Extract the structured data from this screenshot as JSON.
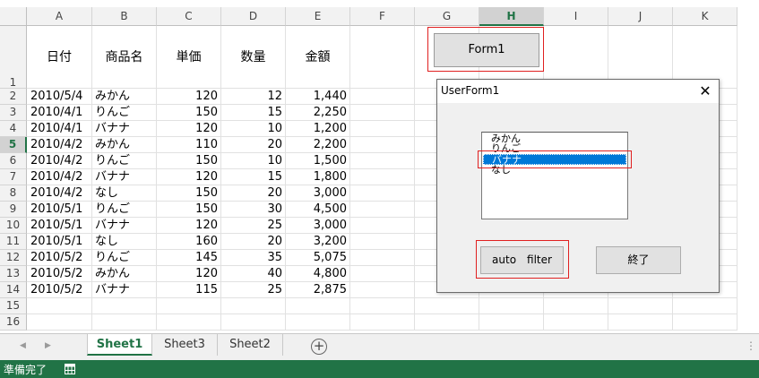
{
  "sheet": {
    "columns": [
      "A",
      "B",
      "C",
      "D",
      "E",
      "F",
      "G",
      "H",
      "I",
      "J",
      "K"
    ],
    "selected_column": "H",
    "selected_row": "5",
    "row_numbers": [
      "1",
      "2",
      "3",
      "4",
      "5",
      "6",
      "7",
      "8",
      "9",
      "10",
      "11",
      "12",
      "13",
      "14",
      "15",
      "16"
    ],
    "headers": [
      "日付",
      "商品名",
      "単価",
      "数量",
      "金額"
    ],
    "rows": [
      [
        "2010/5/4",
        "みかん",
        "120",
        "12",
        "1,440"
      ],
      [
        "2010/4/1",
        "りんご",
        "150",
        "15",
        "2,250"
      ],
      [
        "2010/4/1",
        "バナナ",
        "120",
        "10",
        "1,200"
      ],
      [
        "2010/4/2",
        "みかん",
        "110",
        "20",
        "2,200"
      ],
      [
        "2010/4/2",
        "りんご",
        "150",
        "10",
        "1,500"
      ],
      [
        "2010/4/2",
        "バナナ",
        "120",
        "15",
        "1,800"
      ],
      [
        "2010/4/2",
        "なし",
        "150",
        "20",
        "3,000"
      ],
      [
        "2010/5/1",
        "りんご",
        "150",
        "30",
        "4,500"
      ],
      [
        "2010/5/1",
        "バナナ",
        "120",
        "25",
        "3,000"
      ],
      [
        "2010/5/1",
        "なし",
        "160",
        "20",
        "3,200"
      ],
      [
        "2010/5/2",
        "りんご",
        "145",
        "35",
        "5,075"
      ],
      [
        "2010/5/2",
        "みかん",
        "120",
        "40",
        "4,800"
      ],
      [
        "2010/5/2",
        "バナナ",
        "115",
        "25",
        "2,875"
      ]
    ],
    "form_button_label": "Form1"
  },
  "dialog": {
    "title": "UserForm1",
    "close_glyph": "✕",
    "list_items": [
      "みかん",
      "りんご",
      "バナナ",
      "なし"
    ],
    "selected_item": "バナナ",
    "autofilter_label": "auto　filter",
    "end_label": "終了"
  },
  "tabs": {
    "items": [
      "Sheet1",
      "Sheet3",
      "Sheet2"
    ],
    "active": "Sheet1",
    "prev_glyph": "◀",
    "next_glyph": "▶",
    "add_glyph": "+",
    "menu_glyph": "⋮"
  },
  "status": {
    "text": "準備完了"
  },
  "colors": {
    "accent": "#217346",
    "highlight": "#e02020",
    "selection": "#0078d7"
  }
}
